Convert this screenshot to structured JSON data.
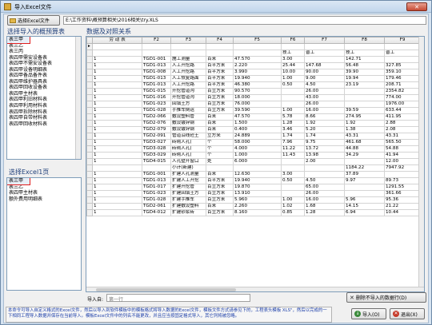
{
  "window": {
    "title": "导入Excel文件",
    "close_glyph": "✕"
  },
  "toolbar": {
    "select_file_label": "选择Excel文件",
    "path": "E:\\工作资料\\概预算相关\\2016相关\\try.XLS"
  },
  "left": {
    "budget_header": "选择导入的概预算表",
    "budget_items": [
      "表三甲",
      "表三乙",
      "表三丙",
      "表四甲需安设备表",
      "表四甲不需安设备表",
      "表四甲设备明细表",
      "表四甲备品备件表",
      "表四甲维护器具表",
      "表四甲回收设备表",
      "表四甲主材表",
      "表四甲利旧材料表",
      "表四甲利用材料表",
      "表四甲拆除材料表",
      "表四甲自带材料表",
      "表四甲回收材料表"
    ],
    "sheet_header": "选择Excel1页",
    "sheet_items": [
      "表三甲",
      "表三乙",
      "表四甲主材表",
      "额外费用明细表"
    ]
  },
  "grid": {
    "header": "数据及对照关系",
    "columns": [
      "劳 动 表",
      "F2",
      "F3",
      "F4",
      "F5",
      "F6",
      "F7",
      "F8",
      "F9"
    ],
    "rows": [
      {
        "marker": "",
        "cells": [
          "",
          "",
          "",
          "",
          "",
          "",
          "",
          "",
          ""
        ]
      },
      {
        "marker": "",
        "cells": [
          "",
          "",
          "",
          "",
          "",
          "技工",
          "普工",
          "技工",
          "普工"
        ]
      },
      {
        "marker": "",
        "cells": [
          "1",
          "TGD1-001",
          "施工测量",
          "百米",
          "47.570",
          "3.00",
          "",
          "142.71",
          ""
        ]
      },
      {
        "marker": "",
        "cells": [
          "1",
          "TGD1-013",
          "人工开挖路",
          "百平方米",
          "2.220",
          "25.44",
          "147.68",
          "56.48",
          "327.85"
        ]
      },
      {
        "marker": "",
        "cells": [
          "1",
          "TGD1-008",
          "人工开挖路",
          "百平方米",
          "3.990",
          "10.00",
          "90.00",
          "39.90",
          "359.10"
        ]
      },
      {
        "marker": "",
        "cells": [
          "1",
          "TGD1-013",
          "人工恢复路面",
          "百平方米",
          "19.940",
          "1.00",
          "9.00",
          "19.94",
          "179.46"
        ]
      },
      {
        "marker": "",
        "cells": [
          "1",
          "TGD1-013",
          "人工开挖路",
          "百平方米",
          "46.380",
          "0.50",
          "4.50",
          "23.19",
          "208.71"
        ]
      },
      {
        "marker": "",
        "cells": [
          "1",
          "TGD1-015",
          "开挖管道沟",
          "百立方米",
          "90.570",
          "",
          "26.00",
          "",
          "2354.82"
        ]
      },
      {
        "marker": "",
        "cells": [
          "1",
          "TGD1-016",
          "开挖管道沟",
          "百立方米",
          "18.000",
          "",
          "43.00",
          "",
          "774.00"
        ]
      },
      {
        "marker": "",
        "cells": [
          "1",
          "TGD1-023",
          "回填土方",
          "百立方米",
          "76.000",
          "",
          "26.00",
          "",
          "1976.00"
        ]
      },
      {
        "marker": "",
        "cells": [
          "1",
          "TGD1-028",
          "手推车倒运",
          "百立方米",
          "39.590",
          "1.00",
          "16.00",
          "39.59",
          "633.44"
        ]
      },
      {
        "marker": "",
        "cells": [
          "1",
          "TGD2-066",
          "敷设塑料管",
          "百米",
          "47.570",
          "5.78",
          "8.66",
          "274.95",
          "411.95"
        ]
      },
      {
        "marker": "",
        "cells": [
          "1",
          "TGD2-076",
          "敷设镀锌钢",
          "百米",
          "1.500",
          "1.28",
          "1.92",
          "1.92",
          "2.88"
        ]
      },
      {
        "marker": "",
        "cells": [
          "1",
          "TGD2-079",
          "敷设镀锌钢",
          "百米",
          "0.400",
          "3.46",
          "5.20",
          "1.38",
          "2.08"
        ]
      },
      {
        "marker": "",
        "cells": [
          "1",
          "TGD2-091",
          "管道沿线砼土",
          "立方米",
          "24.889",
          "1.74",
          "1.74",
          "43.31",
          "43.31"
        ]
      },
      {
        "marker": "",
        "cells": [
          "1",
          "TGD3-027",
          "砖砌人孔(",
          "个",
          "58.000",
          "7.96",
          "9.75",
          "461.68",
          "565.50"
        ]
      },
      {
        "marker": "",
        "cells": [
          "1",
          "TGD3-028",
          "砖砌人孔(",
          "个",
          "4.000",
          "11.22",
          "13.72",
          "44.88",
          "54.88"
        ]
      },
      {
        "marker": "",
        "cells": [
          "1",
          "TGD3-029",
          "砖砌人孔(",
          "个",
          "1.000",
          "11.43",
          "13.98",
          "34.29",
          "41.94"
        ]
      },
      {
        "marker": "",
        "cells": [
          "1",
          "TGD4-015",
          "人孔壁开窗口",
          "处",
          "6.000",
          "",
          "2.00",
          "",
          "12.00"
        ]
      },
      {
        "marker": "",
        "cells": [
          "",
          "",
          "小计(新建)",
          "",
          "",
          "",
          "",
          "1184.22",
          "7947.92"
        ]
      },
      {
        "marker": "",
        "cells": [
          "1",
          "TGD1-001",
          "扩建人孔测量",
          "百米",
          "12.630",
          "3.00",
          "",
          "37.89",
          ""
        ]
      },
      {
        "marker": "",
        "cells": [
          "1",
          "TGD1-013",
          "扩建人工开挖",
          "百平方米",
          "19.940",
          "0.50",
          "4.50",
          "9.97",
          "89.73"
        ]
      },
      {
        "marker": "",
        "cells": [
          "1",
          "TGD1-017",
          "扩建开挖管",
          "百立方米",
          "19.870",
          "",
          "65.00",
          "",
          "1291.55"
        ]
      },
      {
        "marker": "",
        "cells": [
          "1",
          "TGD1-023",
          "扩建回填土方",
          "百立方米",
          "13.910",
          "",
          "26.00",
          "",
          "361.66"
        ]
      },
      {
        "marker": "",
        "cells": [
          "1",
          "TGD1-028",
          "扩建手推车",
          "百立方米",
          "5.960",
          "1.00",
          "16.00",
          "5.96",
          "95.36"
        ]
      },
      {
        "marker": "",
        "cells": [
          "1",
          "TGD2-061",
          "扩建敷设塑料",
          "百米",
          "2.260",
          "1.02",
          "1.68",
          "14.15",
          "21.22"
        ]
      },
      {
        "marker": "",
        "cells": [
          "1",
          "TGD4-012",
          "扩建砂浆砖",
          "百立方米",
          "8.160",
          "0.85",
          "1.28",
          "6.94",
          "10.44"
        ]
      }
    ]
  },
  "bottom": {
    "import_label": "导入自:",
    "import_placeholder": "第一行",
    "delete_label": "删除不导入的数据行(D)",
    "status_text": "本命令可导入自定义格式的Excel文件，然后以导入到软件模板中的模板格式将导入数据的Excel文件，模板文件方式请参见下的，工程表头模板 XLS\"，然后以完成的一下相同工程导入数据并保存在当前导入。模板Excel文件中的列名不能更改，并且应当按固定格式导入，其它列将被忽略。",
    "ok_label": "导入(O)",
    "exit_label": "退出(X)"
  }
}
